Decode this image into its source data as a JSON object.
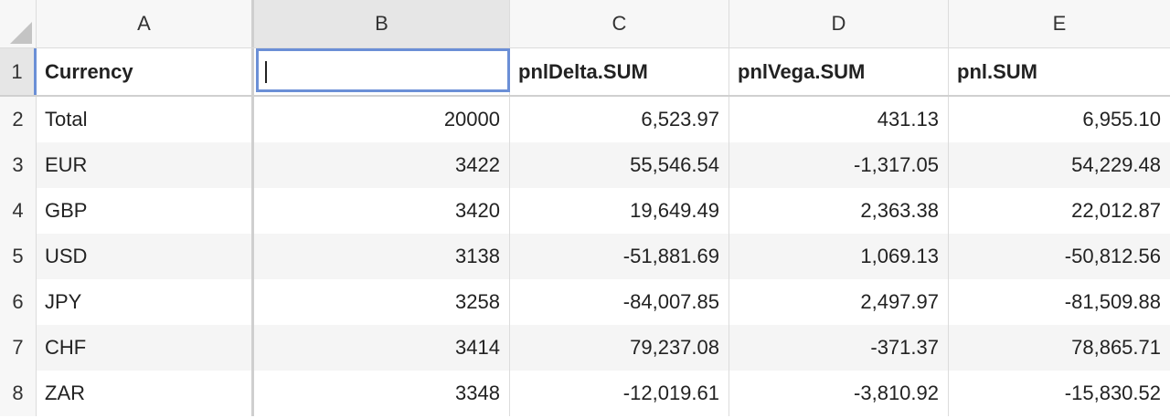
{
  "columns": {
    "a": "A",
    "b": "B",
    "c": "C",
    "d": "D",
    "e": "E"
  },
  "header_row": {
    "num": "1",
    "currency": "Currency",
    "b": "",
    "pnl_delta": "pnlDelta.SUM",
    "pnl_vega": "pnlVega.SUM",
    "pnl": "pnl.SUM"
  },
  "rows": [
    {
      "num": "2",
      "currency": "Total",
      "b": "20000",
      "pnl_delta": "6,523.97",
      "pnl_vega": "431.13",
      "pnl": "6,955.10"
    },
    {
      "num": "3",
      "currency": "EUR",
      "b": "3422",
      "pnl_delta": "55,546.54",
      "pnl_vega": "-1,317.05",
      "pnl": "54,229.48"
    },
    {
      "num": "4",
      "currency": "GBP",
      "b": "3420",
      "pnl_delta": "19,649.49",
      "pnl_vega": "2,363.38",
      "pnl": "22,012.87"
    },
    {
      "num": "5",
      "currency": "USD",
      "b": "3138",
      "pnl_delta": "-51,881.69",
      "pnl_vega": "1,069.13",
      "pnl": "-50,812.56"
    },
    {
      "num": "6",
      "currency": "JPY",
      "b": "3258",
      "pnl_delta": "-84,007.85",
      "pnl_vega": "2,497.97",
      "pnl": "-81,509.88"
    },
    {
      "num": "7",
      "currency": "CHF",
      "b": "3414",
      "pnl_delta": "79,237.08",
      "pnl_vega": "-371.37",
      "pnl": "78,865.71"
    },
    {
      "num": "8",
      "currency": "ZAR",
      "b": "3348",
      "pnl_delta": "-12,019.61",
      "pnl_vega": "-3,810.92",
      "pnl": "-15,830.52"
    }
  ],
  "colors": {
    "selection_border": "#6b8fd6",
    "header_bg": "#f7f7f7",
    "selected_header_bg": "#e6e6e6",
    "stripe_bg": "#f5f5f5"
  }
}
